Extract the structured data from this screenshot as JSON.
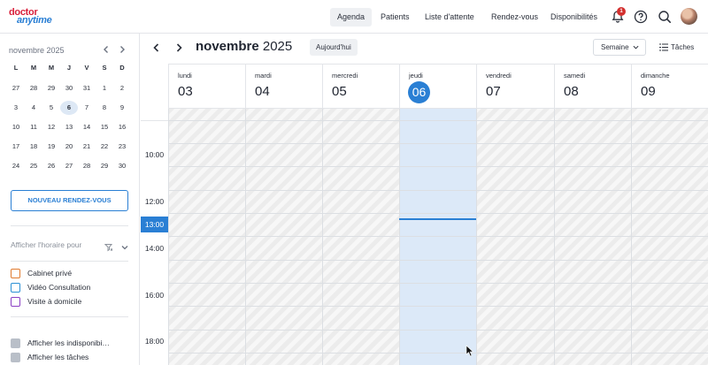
{
  "nav": {
    "logo_line1": "doctor",
    "logo_line2": "anytime",
    "items": [
      "Agenda",
      "Patients",
      "Liste d'attente",
      "Rendez-vous",
      "Disponibilités"
    ],
    "active_item": "Agenda",
    "notification_count": "1",
    "icons": [
      "bell-icon",
      "help-icon",
      "search-icon",
      "avatar"
    ]
  },
  "mini_calendar": {
    "title": "novembre 2025",
    "weekdays": [
      "L",
      "M",
      "M",
      "J",
      "V",
      "S",
      "D"
    ],
    "weeks": [
      [
        "27",
        "28",
        "29",
        "30",
        "31",
        "1",
        "2"
      ],
      [
        "3",
        "4",
        "5",
        "6",
        "7",
        "8",
        "9"
      ],
      [
        "10",
        "11",
        "12",
        "13",
        "14",
        "15",
        "16"
      ],
      [
        "17",
        "18",
        "19",
        "20",
        "21",
        "22",
        "23"
      ],
      [
        "24",
        "25",
        "26",
        "27",
        "28",
        "29",
        "30"
      ]
    ],
    "today": "6"
  },
  "sidebar": {
    "new_appointment": "NOUVEAU RENDEZ-VOUS",
    "schedule_filter_label": "Afficher l'horaire pour",
    "appointment_types": [
      {
        "label": "Cabinet privé",
        "color": "#e07a2e"
      },
      {
        "label": "Vidéo Consultation",
        "color": "#2a8fd4"
      },
      {
        "label": "Visite à domicile",
        "color": "#8a3fc4"
      }
    ],
    "options": [
      "Afficher les indisponibi…",
      "Afficher les tâches"
    ]
  },
  "calendar": {
    "month": "novembre",
    "year": "2025",
    "today_button": "Aujourd'hui",
    "view_select": "Semaine",
    "tasks_button": "Tâches",
    "days": [
      {
        "name": "lundi",
        "num": "03"
      },
      {
        "name": "mardi",
        "num": "04"
      },
      {
        "name": "mercredi",
        "num": "05"
      },
      {
        "name": "jeudi",
        "num": "06"
      },
      {
        "name": "vendredi",
        "num": "07"
      },
      {
        "name": "samedi",
        "num": "08"
      },
      {
        "name": "dimanche",
        "num": "09"
      }
    ],
    "today_index": 3,
    "hour_labels": [
      "10:00",
      "12:00",
      "13:00",
      "14:00",
      "16:00",
      "18:00"
    ],
    "current_hour": "13:00"
  },
  "colors": {
    "accent": "#2a7fd4",
    "brand_red": "#d81f3a",
    "today_column": "#dce9f8"
  }
}
